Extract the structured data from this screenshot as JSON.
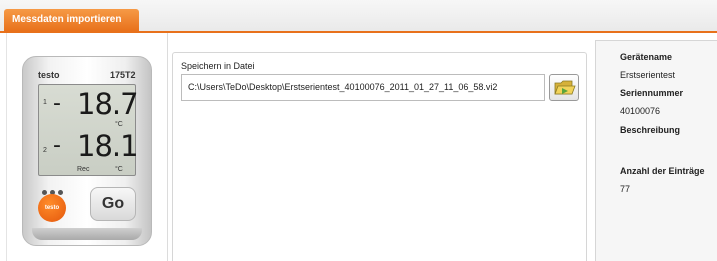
{
  "tab": {
    "label": "Messdaten importieren"
  },
  "device": {
    "brand": "testo",
    "model": "175T2",
    "channel1_label": "1",
    "channel2_label": "2",
    "reading1": "18.7",
    "reading2": "18.1",
    "unit1": "°C",
    "unit2": "°C",
    "rec_label": "Rec",
    "badge_text": "testo",
    "go_label": "Go"
  },
  "file": {
    "label": "Speichern in Datei",
    "path": "C:\\Users\\TeDo\\Desktop\\Erstserientest_40100076_2011_01_27_11_06_58.vi2",
    "browse_icon": "folder-icon"
  },
  "info": {
    "device_name_label": "Gerätename",
    "device_name_value": "Erstserientest",
    "serial_label": "Seriennummer",
    "serial_value": "40100076",
    "description_label": "Beschreibung",
    "description_value": "",
    "entries_label": "Anzahl der Einträge",
    "entries_value": "77"
  },
  "colors": {
    "accent": "#e8711b"
  }
}
